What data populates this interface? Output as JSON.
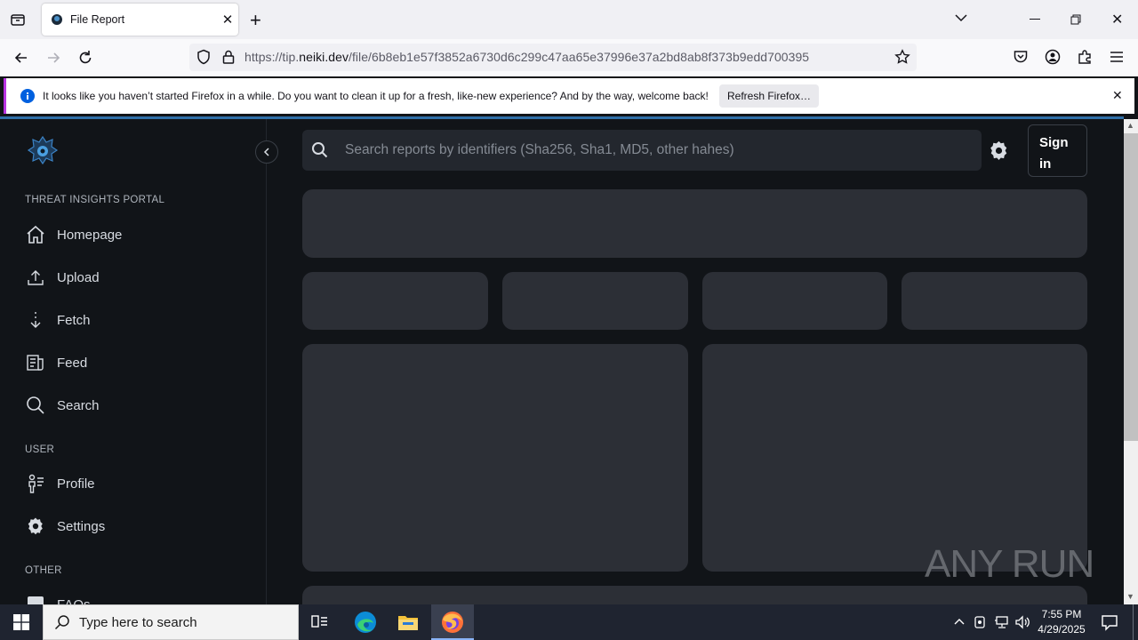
{
  "browser": {
    "tab_title": "File Report",
    "url_prefix": "https://tip.",
    "url_domain": "neiki.dev",
    "url_path": "/file/6b8eb1e57f3852a6730d6c299c47aa65e37996e37a2bd8ab8f373b9edd700395",
    "notification": "It looks like you haven’t started Firefox in a while. Do you want to clean it up for a fresh, like-new experience? And by the way, welcome back!",
    "refresh_label": "Refresh Firefox…"
  },
  "sidebar": {
    "section_portal": "THREAT INSIGHTS PORTAL",
    "section_user": "USER",
    "section_other": "OTHER",
    "items": [
      {
        "label": "Homepage",
        "icon": "home-icon"
      },
      {
        "label": "Upload",
        "icon": "upload-icon"
      },
      {
        "label": "Fetch",
        "icon": "fetch-icon"
      },
      {
        "label": "Feed",
        "icon": "feed-icon"
      },
      {
        "label": "Search",
        "icon": "search-icon"
      }
    ],
    "user_items": [
      {
        "label": "Profile",
        "icon": "profile-icon"
      },
      {
        "label": "Settings",
        "icon": "gear-icon"
      }
    ],
    "other_items": [
      {
        "label": "FAQs",
        "icon": "faq-icon"
      }
    ]
  },
  "header": {
    "search_placeholder": "Search reports by identifiers (Sha256, Sha1, MD5, other hahes)",
    "sign_in_line1": "Sign",
    "sign_in_line2": "in"
  },
  "taskbar": {
    "search_placeholder": "Type here to search",
    "time": "7:55 PM",
    "date": "4/29/2025"
  },
  "watermark": "ANY RUN",
  "colors": {
    "page_bg": "#111418",
    "card_bg": "#2c2f36",
    "accent": "#2f6fa8"
  }
}
